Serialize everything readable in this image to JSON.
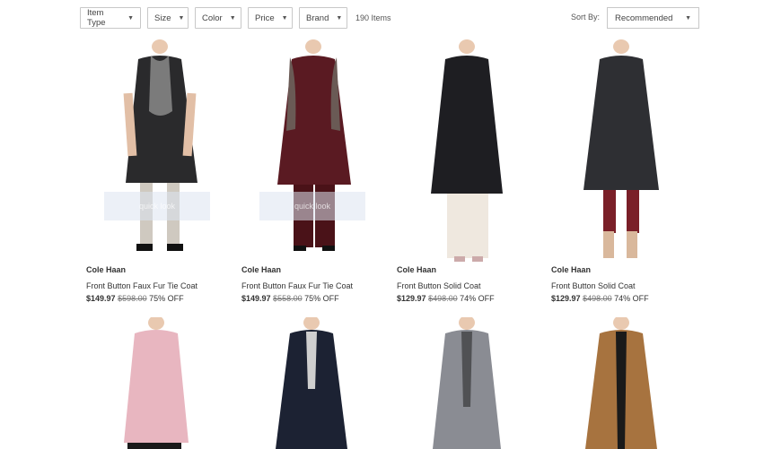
{
  "filters": {
    "item_type": "Item Type",
    "size": "Size",
    "color": "Color",
    "price": "Price",
    "brand": "Brand",
    "item_count": "190 Items"
  },
  "sort": {
    "label": "Sort By:",
    "value": "Recommended"
  },
  "products": [
    {
      "brand": "Cole Haan",
      "name": "Front Button Faux Fur Tie Coat",
      "price": "$149.97",
      "original": "$598.00",
      "discount": "75% OFF",
      "coat_color": "#2a2a2c",
      "accent": "#8a8a8a",
      "quick_look": "quick look"
    },
    {
      "brand": "Cole Haan",
      "name": "Front Button Faux Fur Tie Coat",
      "price": "$149.97",
      "original": "$558.00",
      "discount": "75% OFF",
      "coat_color": "#5a1a22",
      "accent": "#6a5a55",
      "quick_look": "quick look"
    },
    {
      "brand": "Cole Haan",
      "name": "Front Button Solid Coat",
      "price": "$129.97",
      "original": "$498.00",
      "discount": "74% OFF",
      "coat_color": "#1e1e22",
      "accent": "#efe8df"
    },
    {
      "brand": "Cole Haan",
      "name": "Front Button Solid Coat",
      "price": "$129.97",
      "original": "$498.00",
      "discount": "74% OFF",
      "coat_color": "#2e2f33",
      "accent": "#7a1f28"
    },
    {
      "coat_color": "#e8b6c0",
      "accent": "#1a1a1a"
    },
    {
      "coat_color": "#1c2233",
      "accent": "#cfcfcf"
    },
    {
      "coat_color": "#8a8c93",
      "accent": "#2a2a2a"
    },
    {
      "coat_color": "#a7733f",
      "accent": "#1a1a1a"
    }
  ]
}
